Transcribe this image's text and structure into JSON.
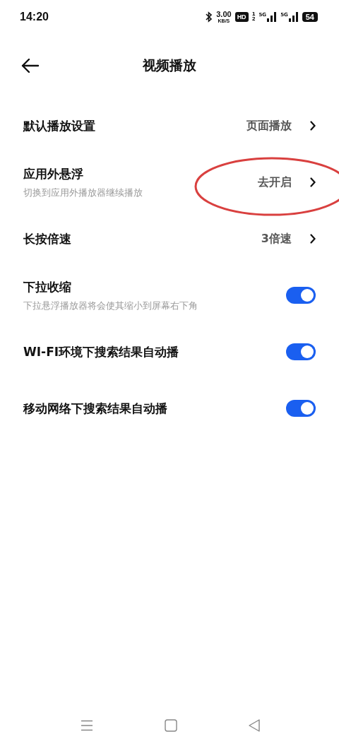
{
  "status_bar": {
    "time": "14:20",
    "speed": "3.00",
    "speed_unit": "KB/S",
    "hd": "HD",
    "sim_1": "1",
    "sim_2": "2",
    "network_1": "5G",
    "network_2": "5G",
    "battery": "54"
  },
  "header": {
    "title": "视频播放"
  },
  "rows": [
    {
      "kind": "link",
      "title": "默认播放设置",
      "value": "页面播放",
      "circled": false
    },
    {
      "kind": "link",
      "title": "应用外悬浮",
      "subtitle": "切换到应用外播放器继续播放",
      "value": "去开启",
      "circled": true
    },
    {
      "kind": "link",
      "title": "长按倍速",
      "value": "3倍速",
      "circled": false
    },
    {
      "kind": "toggle",
      "title": "下拉收缩",
      "subtitle": "下拉悬浮播放器将会使其缩小到屏幕右下角",
      "on": true
    },
    {
      "kind": "toggle",
      "title": "WI-FI环境下搜索结果自动播",
      "on": true
    },
    {
      "kind": "toggle",
      "title": "移动网络下搜索结果自动播",
      "on": true
    }
  ]
}
